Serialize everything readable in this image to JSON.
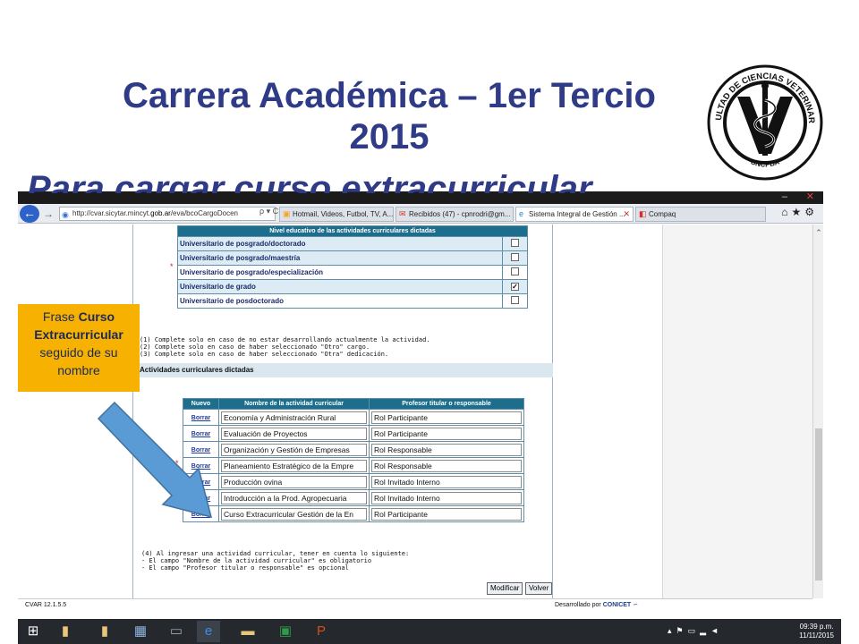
{
  "slide": {
    "title_line1": "Carrera Académica – 1er Tercio",
    "title_line2": "2015",
    "subtitle": "Para cargar curso extracurricular"
  },
  "logo": {
    "text_top": "FACULTAD DE CIENCIAS VETERINARIAS",
    "text_bottom": "UNCPBA",
    "icon": "caduceus-v-seal-icon"
  },
  "browser": {
    "address": {
      "prefix": "http://cvar.sicytar.mincyt.",
      "host": "gob.ar",
      "path": "/eva/bcoCargoDocen",
      "tools": "ρ ▾ C"
    },
    "tabs": [
      {
        "label": "Hotmail, Videos, Futbol, TV, A...",
        "icon": "msn-icon",
        "active": false
      },
      {
        "label": "Recibidos (47) - cpnrodri@gm...",
        "icon": "gmail-icon",
        "active": false
      },
      {
        "label": "Sistema Integral de Gestión ...",
        "icon": "ie-icon",
        "active": true
      },
      {
        "label": "Compaq",
        "icon": "compaq-icon",
        "active": false
      }
    ],
    "nav_icons": [
      "home-icon",
      "star-icon",
      "gear-icon"
    ]
  },
  "nivel_table": {
    "header": "Nivel educativo de las actividades curriculares dictadas",
    "rows": [
      {
        "label": "Universitario de posgrado/doctorado",
        "checked": false
      },
      {
        "label": "Universitario de posgrado/maestría",
        "checked": false
      },
      {
        "label": "Universitario de posgrado/especialización",
        "checked": false
      },
      {
        "label": "Universitario de grado",
        "checked": true
      },
      {
        "label": "Universitario de posdoctorado",
        "checked": false
      }
    ],
    "checkmark": "✓"
  },
  "notes": {
    "line1": "(1) Complete solo en caso de no estar desarrollando actualmente la actividad.",
    "line2": "(2) Complete solo en caso de haber seleccionado \"Otro\" cargo.",
    "line3": "(3) Complete solo en caso de haber seleccionado \"Otra\" dedicación."
  },
  "section": {
    "title": "Actividades curriculares dictadas"
  },
  "act_table": {
    "col_new": "Nuevo",
    "col_name": "Nombre de la actividad curricular",
    "col_prof": "Profesor titular o responsable",
    "link_label": "Borrar",
    "rows": [
      {
        "name": "Economía y Administración Rural",
        "prof": "Rol Participante"
      },
      {
        "name": "Evaluación de Proyectos",
        "prof": "Rol Participante"
      },
      {
        "name": "Organización y Gestión de Empresas",
        "prof": "Rol Responsable"
      },
      {
        "name": "Planeamiento Estratégico de la Empre",
        "prof": "Rol Responsable"
      },
      {
        "name": "Producción ovina",
        "prof": "Rol Invitado Interno"
      },
      {
        "name": "Introducción a la Prod. Agropecuaria",
        "prof": "Rol Invitado Interno"
      },
      {
        "name": "Curso Extracurricular Gestión de la En",
        "prof": "Rol Participante"
      }
    ]
  },
  "notes2": {
    "line1": "(4) Al ingresar una actividad curricular, tener en cuenta lo siguiente:",
    "line2": "- El campo \"Nombre de la actividad curricular\" es obligatorio",
    "line3": "- El campo \"Profesor titular o responsable\" es opcional"
  },
  "buttons": {
    "modificar": "Modificar",
    "volver": "Volver"
  },
  "status": {
    "version": "CVAR  12.1.5.5",
    "developed": "Desarrollado por",
    "brand": "CONICET"
  },
  "callout": {
    "pre": "Frase ",
    "bold": "Curso Extracurricular",
    "post": " seguido de su nombre"
  },
  "taskbar": {
    "time": "09:39 p.m.",
    "date": "11/11/2015",
    "icons": [
      "windows-start-icon",
      "file-icon",
      "file-icon",
      "network-icon",
      "computer-icon",
      "ie-icon",
      "folder-icon",
      "excel-icon",
      "powerpoint-icon"
    ]
  },
  "colors": {
    "title": "#2f3b86",
    "callout_bg": "#f7b100",
    "arrow": "#5b9bd5",
    "table_header": "#1c6e8c"
  }
}
